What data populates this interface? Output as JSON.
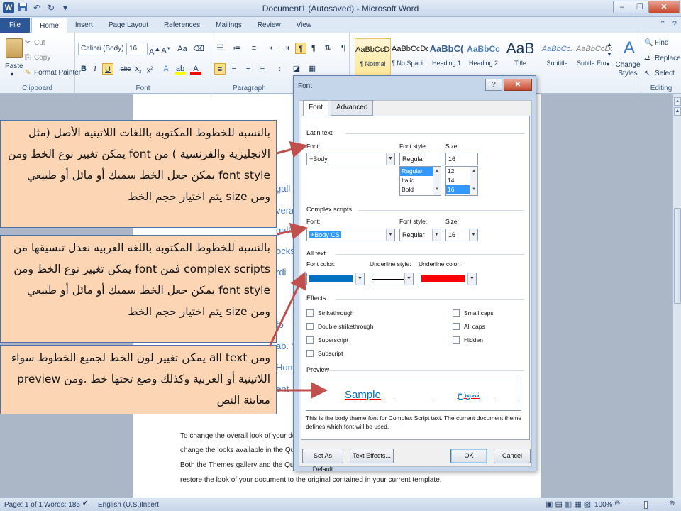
{
  "window": {
    "title": "Document1 (Autosaved) - Microsoft Word",
    "minimize_glyph": "–",
    "restore_glyph": "❐",
    "close_glyph": "✕",
    "qat": {
      "undo_glyph": "↶",
      "redo_glyph": "↻",
      "customize_glyph": "▾"
    }
  },
  "ribbon_tabs": [
    {
      "label": "File"
    },
    {
      "label": "Home"
    },
    {
      "label": "Insert"
    },
    {
      "label": "Page Layout"
    },
    {
      "label": "References"
    },
    {
      "label": "Mailings"
    },
    {
      "label": "Review"
    },
    {
      "label": "View"
    }
  ],
  "ribbon": {
    "clipboard": {
      "paste": "Paste",
      "cut": "Cut",
      "copy": "Copy",
      "format_painter": "Format Painter",
      "label": "Clipboard"
    },
    "font": {
      "font_name": "Calibri (Body)",
      "font_size": "16",
      "label": "Font"
    },
    "paragraph": {
      "label": "Paragraph"
    },
    "styles": {
      "label": "Styles",
      "tiles": [
        {
          "sample": "AaBbCcDc",
          "name": "¶ Normal"
        },
        {
          "sample": "AaBbCcDc",
          "name": "¶ No Spaci..."
        },
        {
          "sample": "AaBbC(",
          "name": "Heading 1"
        },
        {
          "sample": "AaBbCc",
          "name": "Heading 2"
        },
        {
          "sample": "AaB",
          "name": "Title"
        },
        {
          "sample": "AaBbCc.",
          "name": "Subtitle"
        },
        {
          "sample": "AaBbCcDc",
          "name": "Subtle Em..."
        }
      ],
      "change_styles": "Change Styles"
    },
    "editing": {
      "find": "Find",
      "replace": "Replace",
      "select": "Select",
      "label": "Editing"
    }
  },
  "document": {
    "fragments": [
      "gall",
      "vera",
      "galleries to insert tables, h",
      "ocks.",
      "rdi",
      "fo",
      "ab. Y",
      "Hom",
      "ent"
    ],
    "paragraph_lines": [
      "To change the overall look of your doc",
      "change the looks available in the Quic",
      "Both the Themes gallery and the Quic",
      "restore the look of your document to the original contained in your current template."
    ]
  },
  "statusbar": {
    "page": "Page: 1 of 1",
    "words": "Words: 185",
    "language": "English (U.S.)",
    "mode": "Insert",
    "zoom": "100%"
  },
  "callouts": [
    "بالنسبة للخطوط المكتوبة باللغات اللاتينية الأصل (مثل الانجليزية والفرنسية ) من font يمكن تغيير نوع الخط ومن font style يمكن جعل الخط سميك أو مائل أو طبيعي ومن size يتم اختيار حجم الخط",
    "بالنسبة للخطوط المكتوبة باللغة العربية نعدل تنسيقها من complex scripts فمن font يمكن تغيير نوع الخط ومن font style يمكن جعل الخط سميك أو مائل أو طبيعي ومن size يتم اختيار حجم الخط",
    "ومن all text يمكن تغيير لون الخط لجميع الخطوط سواء اللاتينية أو العربية وكذلك وضع تحتها خط .ومن preview معاينة النص"
  ],
  "dialog": {
    "title": "Font",
    "help": "?",
    "close": "✕",
    "tabs": [
      {
        "label": "Font"
      },
      {
        "label": "Advanced"
      }
    ],
    "latin": {
      "section": "Latin text",
      "font_label": "Font:",
      "font_value": "+Body",
      "style_label": "Font style:",
      "style_value": "Regular",
      "size_label": "Size:",
      "size_value": "16",
      "style_options": [
        "Regular",
        "Italic",
        "Bold"
      ],
      "size_options": [
        "12",
        "14",
        "16"
      ]
    },
    "complex": {
      "section": "Complex scripts",
      "font_label": "Font:",
      "font_value": "+Body CS",
      "style_label": "Font style:",
      "style_value": "Regular",
      "size_label": "Size:",
      "size_value": "16"
    },
    "all_text": {
      "section": "All text",
      "color_label": "Font color:",
      "underline_style_label": "Underline style:",
      "underline_color_label": "Underline color:",
      "font_color": "#0070c0",
      "underline_color": "#ff0000"
    },
    "effects": {
      "section": "Effects",
      "left": [
        "Strikethrough",
        "Double strikethrough",
        "Superscript",
        "Subscript"
      ],
      "right": [
        "Small caps",
        "All caps",
        "Hidden"
      ]
    },
    "preview": {
      "section": "Preview",
      "latin_sample": "Sample",
      "arabic_sample": "نموذج",
      "note": "This is the body theme font for Complex Script text. The current document theme defines which font will be used."
    },
    "buttons": {
      "default": "Set As Default",
      "effects": "Text Effects...",
      "ok": "OK",
      "cancel": "Cancel"
    }
  }
}
